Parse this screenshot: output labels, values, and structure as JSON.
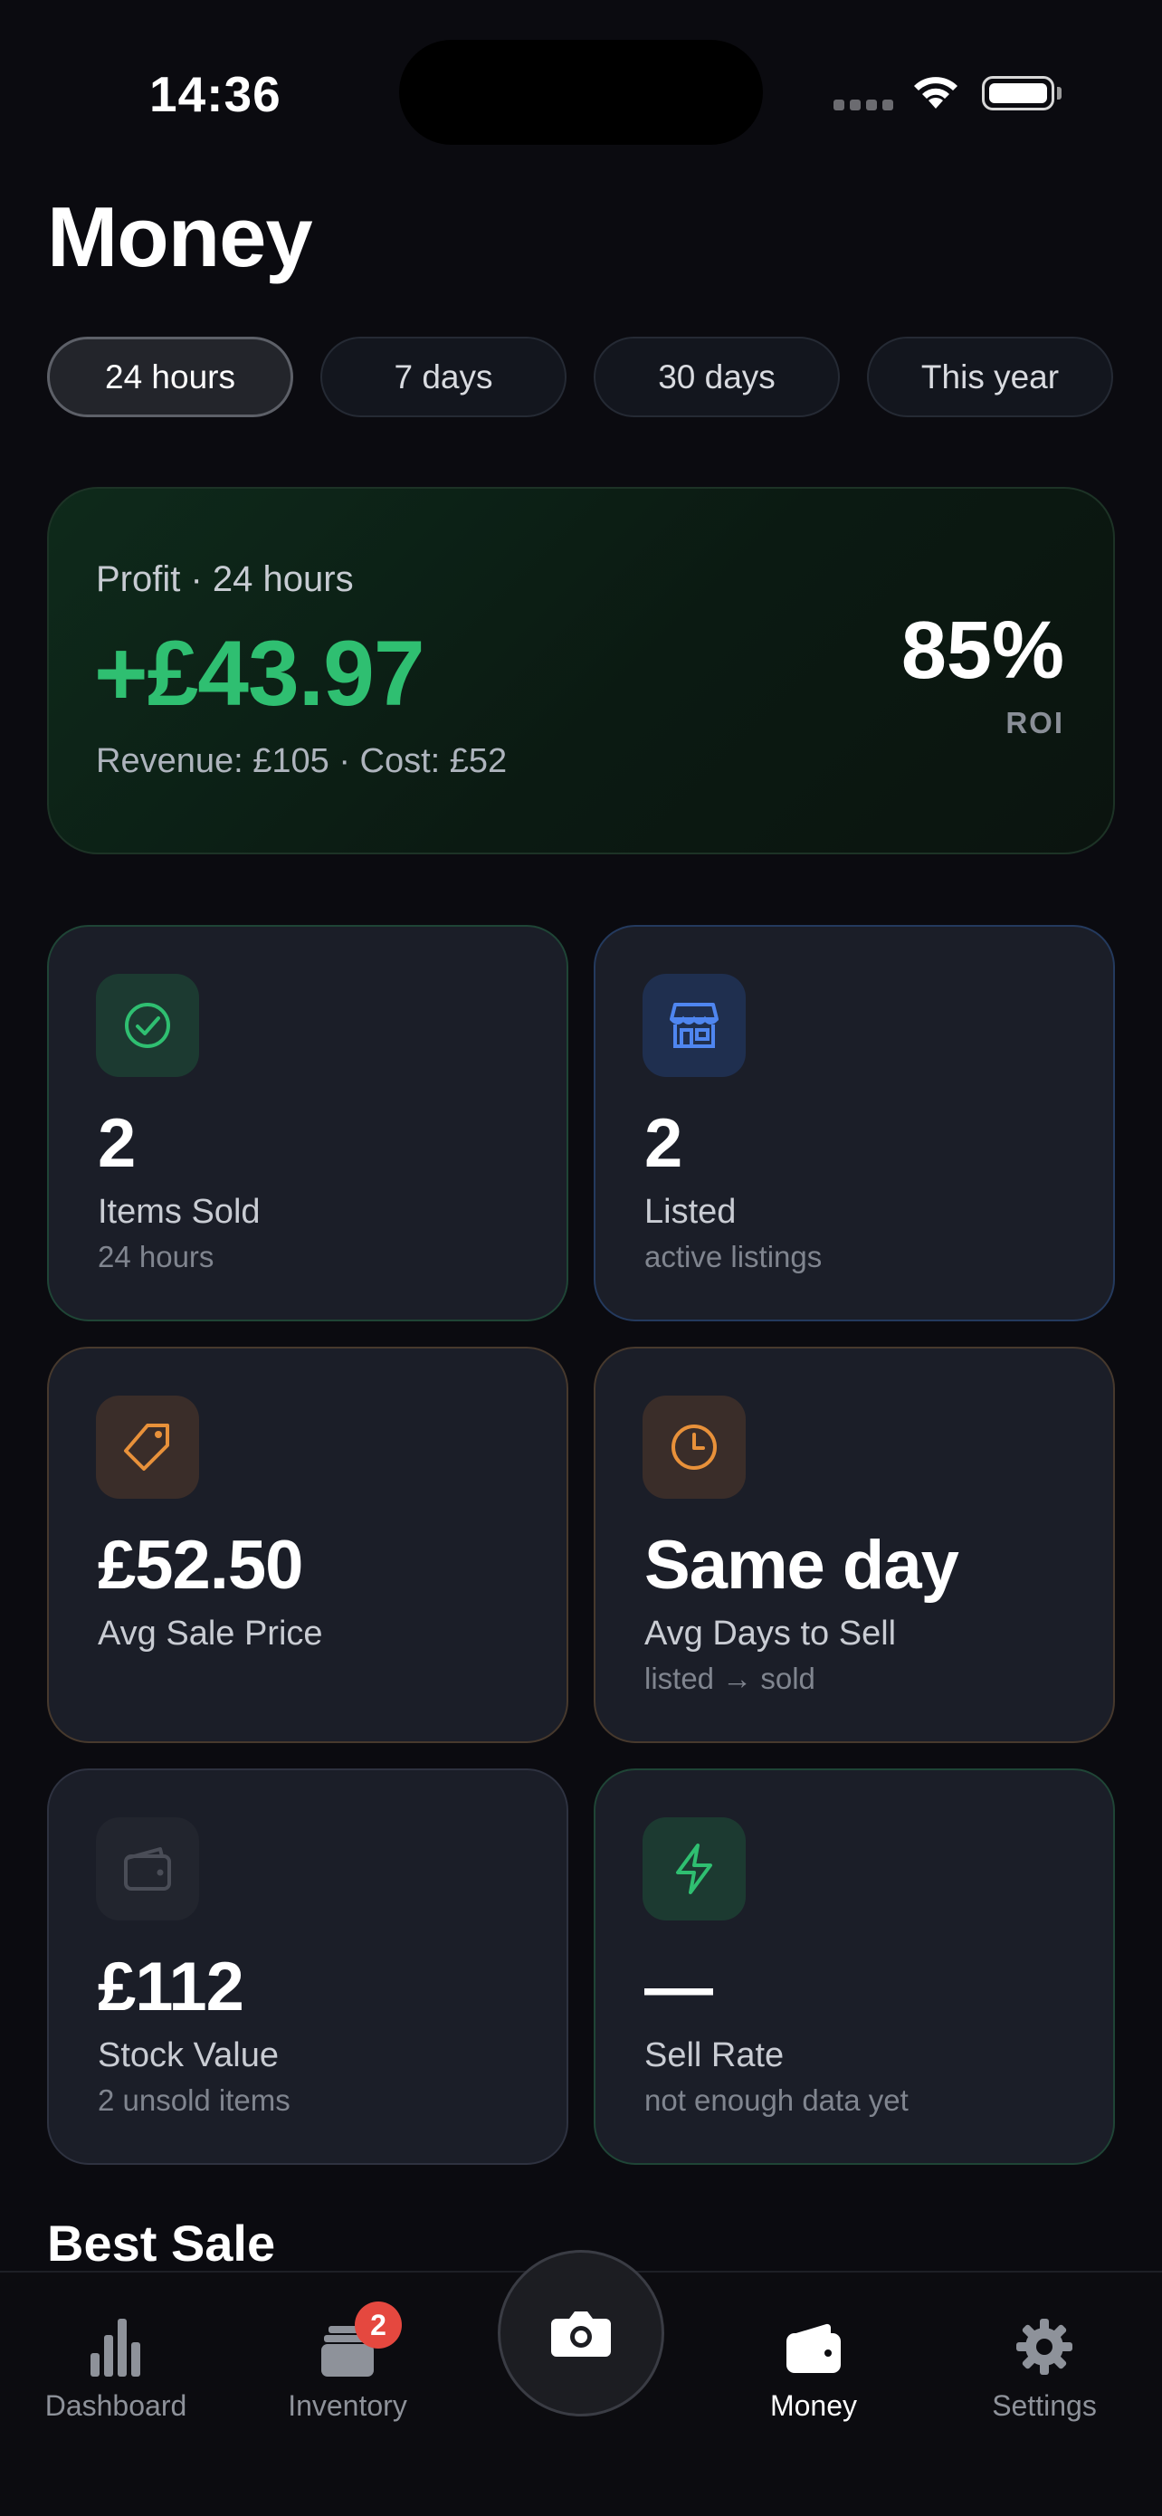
{
  "status_bar": {
    "time": "14:36"
  },
  "header": {
    "title": "Money"
  },
  "filters": [
    {
      "label": "24 hours",
      "active": true
    },
    {
      "label": "7 days",
      "active": false
    },
    {
      "label": "30 days",
      "active": false
    },
    {
      "label": "This year",
      "active": false
    }
  ],
  "profit": {
    "label": "Profit · 24 hours",
    "value": "+£43.97",
    "breakdown": "Revenue: £105 · Cost: £52",
    "roi_value": "85%",
    "roi_label": "ROI",
    "accent_color": "#2fbf71"
  },
  "stats": [
    {
      "icon": "check-circle-icon",
      "value": "2",
      "label": "Items Sold",
      "sub": "24 hours",
      "color": "#2fbf71"
    },
    {
      "icon": "storefront-icon",
      "value": "2",
      "label": "Listed",
      "sub": "active listings",
      "color": "#4f86f0"
    },
    {
      "icon": "tag-icon",
      "value": "£52.50",
      "label": "Avg Sale Price",
      "sub": "",
      "color": "#e8913a"
    },
    {
      "icon": "clock-icon",
      "value": "Same day",
      "label": "Avg Days to Sell",
      "sub": "listed → sold",
      "color": "#e8913a"
    },
    {
      "icon": "wallet-icon",
      "value": "£112",
      "label": "Stock Value",
      "sub": "2 unsold items",
      "color": "#4a4d57"
    },
    {
      "icon": "lightning-icon",
      "value": "—",
      "label": "Sell Rate",
      "sub": "not enough data yet",
      "color": "#2fbf71"
    }
  ],
  "best_sale": {
    "title": "Best Sale"
  },
  "tab_bar": {
    "items": [
      {
        "label": "Dashboard",
        "icon": "bar-chart-icon",
        "active": false
      },
      {
        "label": "Inventory",
        "icon": "inventory-stack-icon",
        "active": false,
        "badge": "2"
      },
      {
        "label": "",
        "icon": "camera-icon",
        "active": false
      },
      {
        "label": "Money",
        "icon": "wallet-icon",
        "active": true
      },
      {
        "label": "Settings",
        "icon": "gear-icon",
        "active": false
      }
    ]
  }
}
